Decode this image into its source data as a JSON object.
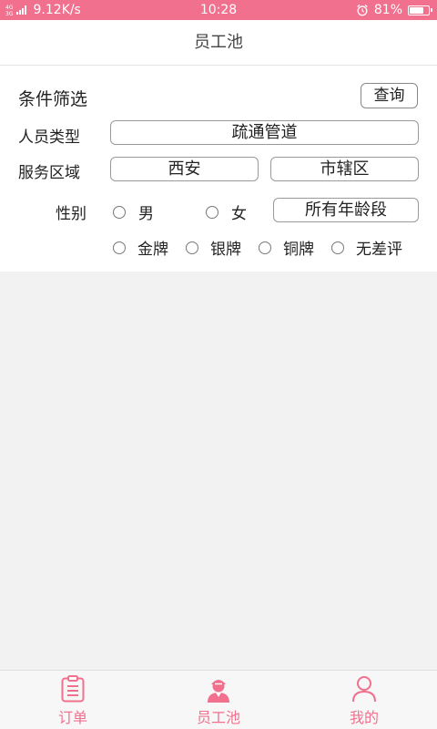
{
  "status_bar": {
    "network_top": "4G",
    "network_bottom": "3G",
    "speed": "9.12K/s",
    "time": "10:28",
    "battery": "81%",
    "battery_level": 0.81
  },
  "header": {
    "title": "员工池"
  },
  "filter": {
    "title": "条件筛选",
    "query_label": "查询",
    "personnel_type_label": "人员类型",
    "personnel_type_value": "疏通管道",
    "service_area_label": "服务区域",
    "city_value": "西安",
    "district_value": "市辖区",
    "gender_label": "性别",
    "gender_male": "男",
    "gender_female": "女",
    "age_value": "所有年龄段",
    "level_gold": "金牌",
    "level_silver": "银牌",
    "level_bronze": "铜牌",
    "level_no_bad": "无差评"
  },
  "tabs": [
    {
      "label": "订单",
      "icon": "clipboard-icon"
    },
    {
      "label": "员工池",
      "icon": "staff-icon"
    },
    {
      "label": "我的",
      "icon": "profile-icon"
    }
  ],
  "colors": {
    "accent": "#f0708e"
  }
}
